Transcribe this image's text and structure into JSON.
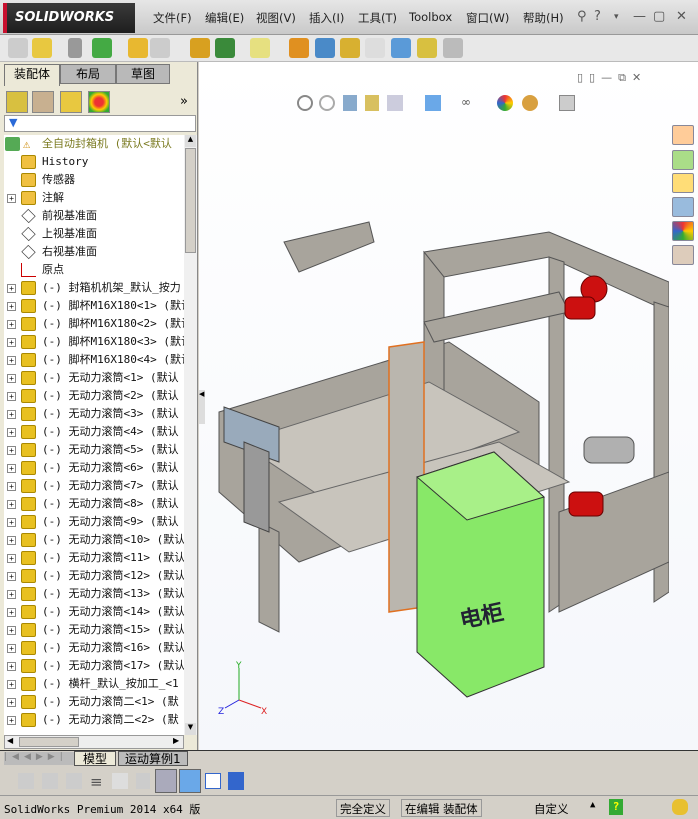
{
  "app": {
    "logo": "SOLIDWORKS"
  },
  "menu": [
    "文件(F)",
    "编辑(E)",
    "视图(V)",
    "插入(I)",
    "工具(T)",
    "Toolbox",
    "窗口(W)",
    "帮助(H)"
  ],
  "panel": {
    "tabs": [
      "装配体",
      "布局",
      "草图"
    ],
    "more": "»"
  },
  "tree": {
    "root": "全自动封箱机  (默认<默认",
    "items": [
      {
        "label": "History",
        "type": "history",
        "expand": false
      },
      {
        "label": "传感器",
        "type": "sensor",
        "expand": false
      },
      {
        "label": "注解",
        "type": "annotation",
        "expand": true
      },
      {
        "label": "前视基准面",
        "type": "plane",
        "expand": false
      },
      {
        "label": "上视基准面",
        "type": "plane",
        "expand": false
      },
      {
        "label": "右视基准面",
        "type": "plane",
        "expand": false
      },
      {
        "label": "原点",
        "type": "origin",
        "expand": false
      },
      {
        "label": "(-) 封箱机机架_默认_按力",
        "type": "part",
        "expand": true
      },
      {
        "label": "(-) 脚杯M16X180<1> (默认",
        "type": "part",
        "expand": true
      },
      {
        "label": "(-) 脚杯M16X180<2> (默认",
        "type": "part",
        "expand": true
      },
      {
        "label": "(-) 脚杯M16X180<3> (默认",
        "type": "part",
        "expand": true
      },
      {
        "label": "(-) 脚杯M16X180<4> (默认",
        "type": "part",
        "expand": true
      },
      {
        "label": "(-) 无动力滚筒<1> (默认",
        "type": "part",
        "expand": true
      },
      {
        "label": "(-) 无动力滚筒<2> (默认",
        "type": "part",
        "expand": true
      },
      {
        "label": "(-) 无动力滚筒<3> (默认",
        "type": "part",
        "expand": true
      },
      {
        "label": "(-) 无动力滚筒<4> (默认",
        "type": "part",
        "expand": true
      },
      {
        "label": "(-) 无动力滚筒<5> (默认",
        "type": "part",
        "expand": true
      },
      {
        "label": "(-) 无动力滚筒<6> (默认",
        "type": "part",
        "expand": true
      },
      {
        "label": "(-) 无动力滚筒<7> (默认",
        "type": "part",
        "expand": true
      },
      {
        "label": "(-) 无动力滚筒<8> (默认",
        "type": "part",
        "expand": true
      },
      {
        "label": "(-) 无动力滚筒<9> (默认",
        "type": "part",
        "expand": true
      },
      {
        "label": "(-) 无动力滚筒<10> (默认",
        "type": "part",
        "expand": true
      },
      {
        "label": "(-) 无动力滚筒<11> (默认",
        "type": "part",
        "expand": true
      },
      {
        "label": "(-) 无动力滚筒<12> (默认",
        "type": "part",
        "expand": true
      },
      {
        "label": "(-) 无动力滚筒<13> (默认",
        "type": "part",
        "expand": true
      },
      {
        "label": "(-) 无动力滚筒<14> (默认",
        "type": "part",
        "expand": true
      },
      {
        "label": "(-) 无动力滚筒<15> (默认",
        "type": "part",
        "expand": true
      },
      {
        "label": "(-) 无动力滚筒<16> (默认",
        "type": "part",
        "expand": true
      },
      {
        "label": "(-) 无动力滚筒<17> (默认",
        "type": "part",
        "expand": true
      },
      {
        "label": "(-) 横杆_默认_按加工_<1",
        "type": "part",
        "expand": true
      },
      {
        "label": "(-) 无动力滚筒二<1> (默",
        "type": "part",
        "expand": true
      },
      {
        "label": "(-) 无动力滚筒二<2> (默",
        "type": "part",
        "expand": true
      }
    ]
  },
  "model": {
    "cabinet_label": "电柜",
    "axes": {
      "x": "X",
      "y": "Y",
      "z": "Z"
    }
  },
  "bottom_tabs": [
    "模型",
    "运动算例1"
  ],
  "status": {
    "product": "SolidWorks Premium 2014 x64 版",
    "definition": "完全定义",
    "mode": "在编辑 装配体",
    "units": "自定义",
    "help": "?"
  },
  "colors": {
    "cabinet": "#90ee70",
    "motor": "#cc1010",
    "frame": "#a09c94",
    "accent": "#c8102e"
  }
}
